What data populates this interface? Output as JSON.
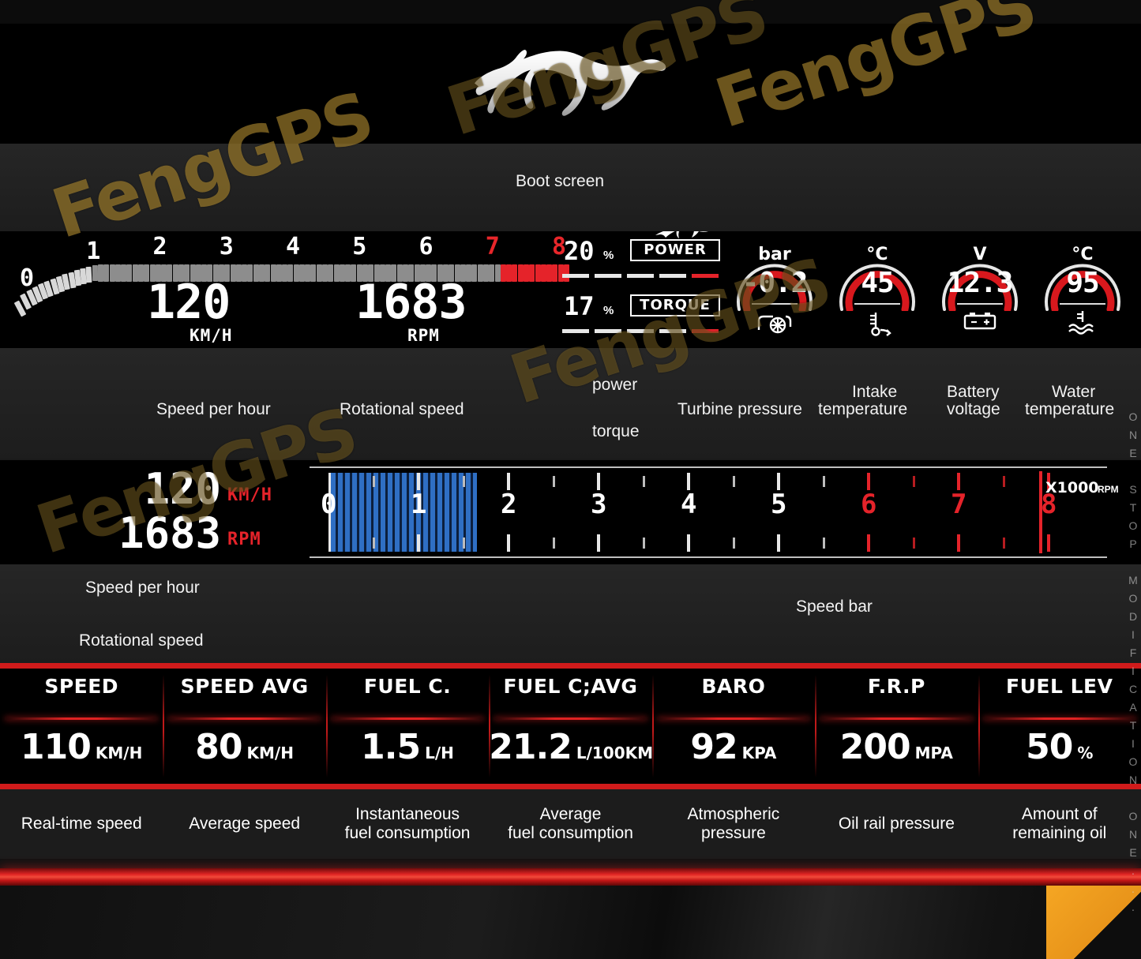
{
  "watermark": {
    "brand": "FengGPS",
    "vertical": "ONE STOP MODIFICATION ONE..."
  },
  "boot": {
    "logo_icon": "mustang-running-horse-icon",
    "caption": "Boot screen"
  },
  "panel_tach": {
    "tach_ticks": [
      "0",
      "1",
      "2",
      "3",
      "4",
      "5",
      "6",
      "7",
      "8"
    ],
    "redline_from": 7,
    "speed": {
      "value": "120",
      "unit": "KM/H"
    },
    "rpm": {
      "value": "1683",
      "unit": "RPM"
    },
    "power": {
      "percent": "20",
      "percent_symbol": "%",
      "label": "POWER",
      "fill_pct": 20
    },
    "torque": {
      "percent": "17",
      "percent_symbol": "%",
      "label": "TORQUE",
      "fill_pct": 17
    },
    "gauges": [
      {
        "unit": "bar",
        "value": "-0.2",
        "icon": "turbocharger-icon",
        "arc_pct": 35
      },
      {
        "unit": "°C",
        "value": "45",
        "icon": "intake-temperature-icon",
        "arc_pct": 45
      },
      {
        "unit": "V",
        "value": "12.3",
        "icon": "battery-icon",
        "arc_pct": 60
      },
      {
        "unit": "°C",
        "value": "95",
        "icon": "water-temperature-icon",
        "arc_pct": 70
      }
    ]
  },
  "caption_tach": {
    "speed": "Speed per hour",
    "rpm": "Rotational speed",
    "power": "power",
    "torque": "torque",
    "turbine": "Turbine pressure",
    "intake_1": "Intake",
    "intake_2": "temperature",
    "battery_1": "Battery",
    "battery_2": "voltage",
    "water_1": "Water",
    "water_2": "temperature"
  },
  "panel_bar": {
    "speed": {
      "value": "120",
      "unit": "KM/H"
    },
    "rpm": {
      "value": "1683",
      "unit": "RPM"
    },
    "scale_ticks": [
      "0",
      "1",
      "2",
      "3",
      "4",
      "5",
      "6",
      "7",
      "8"
    ],
    "redline_from": 6,
    "fill_to": 1.65,
    "multiplier": "X1000",
    "multiplier_unit": "RPM"
  },
  "caption_bar": {
    "speed": "Speed per hour",
    "rpm": "Rotational speed",
    "bar": "Speed bar"
  },
  "table": {
    "columns": [
      {
        "header": "SPEED",
        "value": "110",
        "unit": "KM/H",
        "desc": "Real-time speed"
      },
      {
        "header": "SPEED AVG",
        "value": "80",
        "unit": "KM/H",
        "desc": "Average speed"
      },
      {
        "header": "FUEL C.",
        "value": "1.5",
        "unit": "L/H",
        "desc": "Instantaneous\nfuel consumption"
      },
      {
        "header": "FUEL C;AVG",
        "value": "21.2",
        "unit": "L/100KM",
        "desc": "Average\nfuel consumption"
      },
      {
        "header": "BARO",
        "value": "92",
        "unit": "KPA",
        "desc": "Atmospheric\npressure"
      },
      {
        "header": "F.R.P",
        "value": "200",
        "unit": "MPA",
        "desc": "Oil rail pressure"
      },
      {
        "header": "FUEL LEV",
        "value": "50",
        "unit": "%",
        "desc": "Amount of\nremaining oil"
      }
    ]
  },
  "colors": {
    "accent_red": "#e0242 4",
    "redline": "#e5232a",
    "bar_blue": "#2f6fc4",
    "watermark_gold": "#c49a34",
    "footer_orange": "#f5a623"
  }
}
